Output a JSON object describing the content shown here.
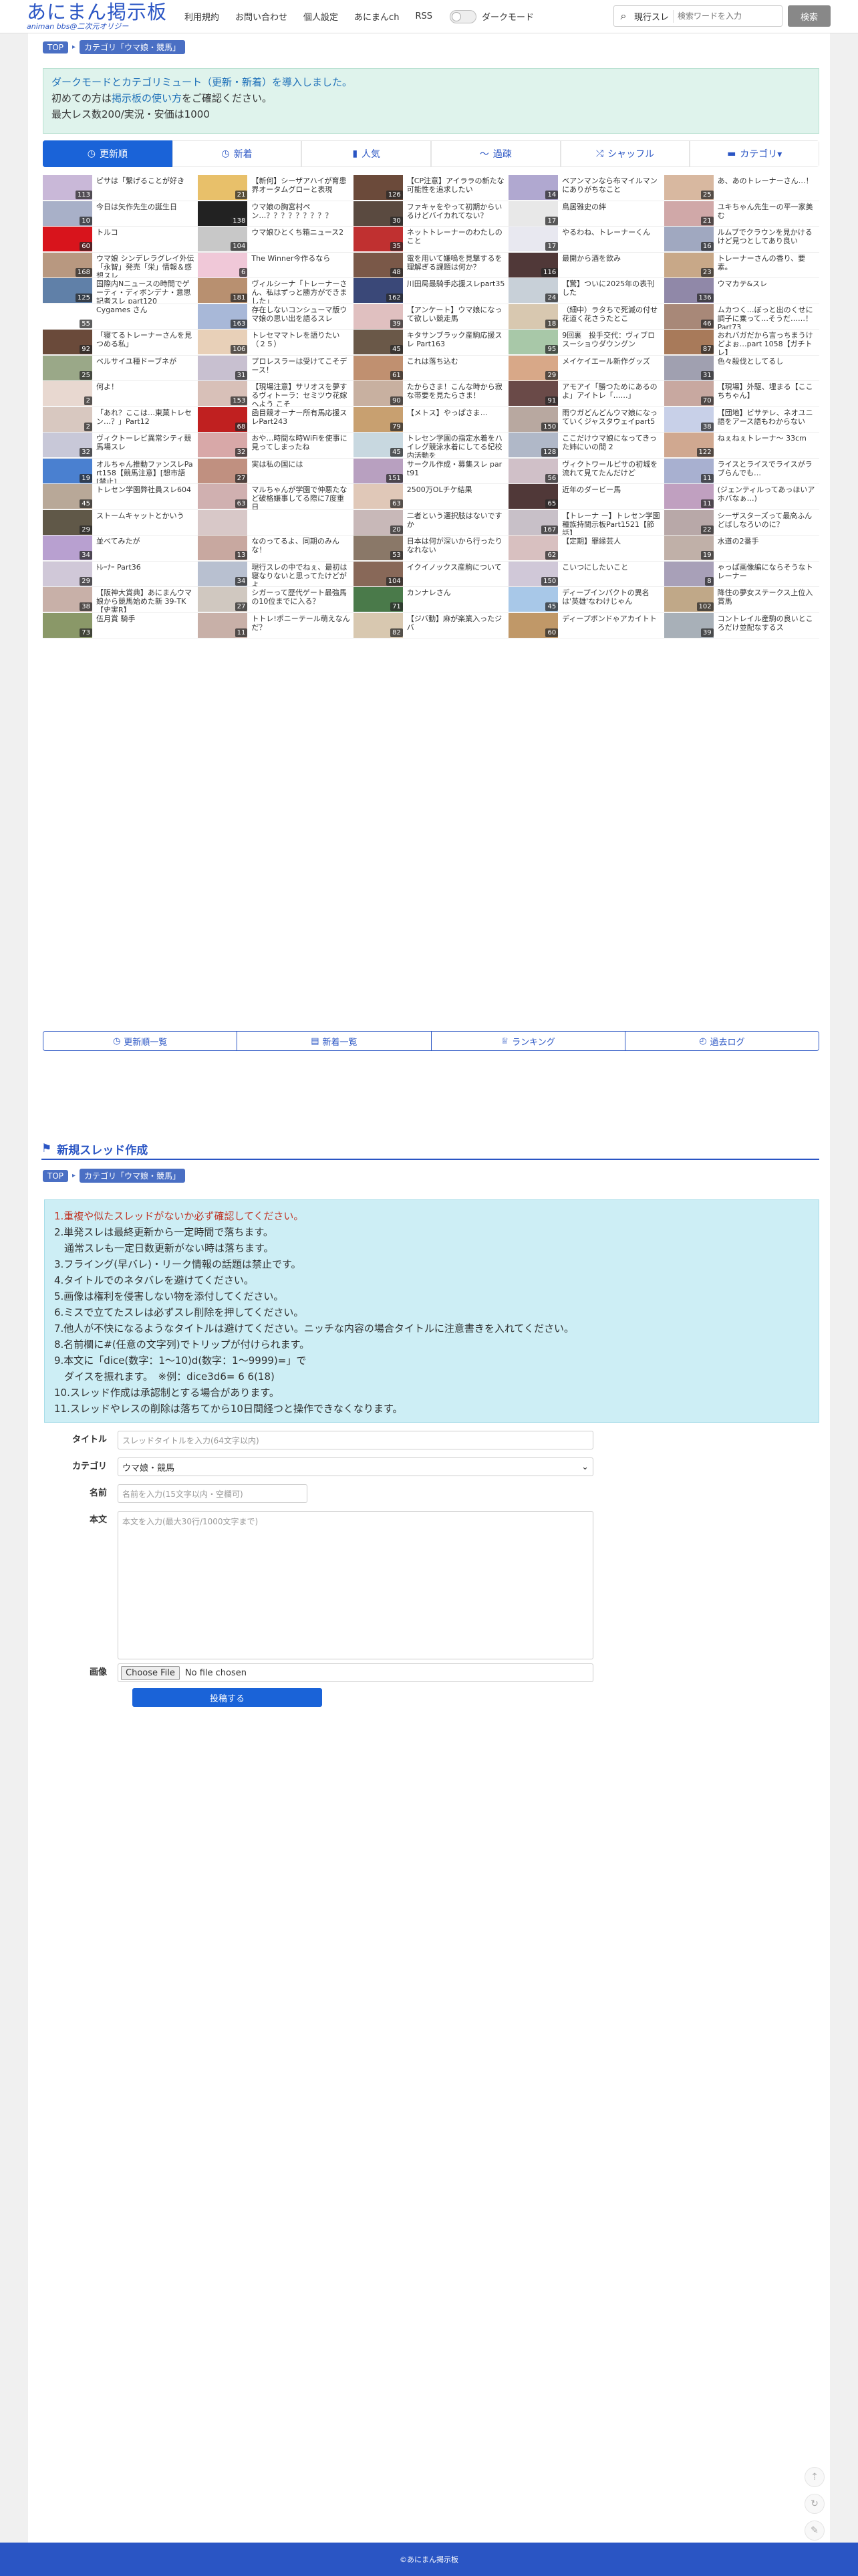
{
  "header": {
    "logo_title": "あにまん掲示板",
    "logo_sub": "animan bbs@二次元オリジー",
    "nav": [
      "利用規約",
      "お問い合わせ",
      "個人設定",
      "あにまんch",
      "RSS"
    ],
    "darkmode_label": "ダークモード",
    "search_scope": "現行スレ",
    "search_placeholder": "検索ワードを入力",
    "search_button": "検索"
  },
  "breadcrumb": {
    "top": "TOP",
    "category": "カテゴリ「ウマ娘・競馬」"
  },
  "notice": {
    "line1": "ダークモードとカテゴリミュート（更新・新着）を導入しました。",
    "line2_pre": "初めての方は",
    "line2_link": "掲示板の使い方",
    "line2_post": "をご確認ください。",
    "line3": "最大レス数200/実況・安価は1000"
  },
  "tabs": [
    {
      "label": "更新順",
      "icon": "clock-icon",
      "glyph": "◷"
    },
    {
      "label": "新着",
      "icon": "clock-icon",
      "glyph": "◷"
    },
    {
      "label": "人気",
      "icon": "bar-chart-icon",
      "glyph": "▮"
    },
    {
      "label": "過疎",
      "icon": "graph-icon",
      "glyph": "〜"
    },
    {
      "label": "シャッフル",
      "icon": "shuffle-icon",
      "glyph": "⤮"
    },
    {
      "label": "カテゴリ▾",
      "icon": "folder-icon",
      "glyph": "▬"
    }
  ],
  "threads": [
    {
      "title": "ピサは「繋げることが好き",
      "count": "113",
      "color": "#c9b8d8"
    },
    {
      "title": "【新何】シーザアハイが育患界オータムグローと表現",
      "count": "21",
      "color": "#e8c06a"
    },
    {
      "title": "【CP注意】アイララの新たな可能性を追求したい",
      "count": "126",
      "color": "#6b4a3a"
    },
    {
      "title": "ベアンマンなら布マイルマンにありがちなこと",
      "count": "14",
      "color": "#b0a8d0"
    },
    {
      "title": "あ、あのトレーナーさん…！",
      "count": "25",
      "color": "#d8b8a0"
    },
    {
      "title": "今日は矢作先生の誕生日",
      "count": "10",
      "color": "#a8b0c8"
    },
    {
      "title": "ウマ娘の胸宮村ペン…？？？？？？？？？",
      "count": "138",
      "color": "#222222"
    },
    {
      "title": "ファキャをやって初期からいるけどバイカれてない？",
      "count": "30",
      "color": "#5a4a40"
    },
    {
      "title": "鳥居雅史の絆",
      "count": "17",
      "color": "#e8e8e8"
    },
    {
      "title": "ユキちゃん先生ーの平一家美む",
      "count": "21",
      "color": "#d0a8a8"
    },
    {
      "title": "トルコ",
      "count": "60",
      "color": "#d8141c"
    },
    {
      "title": "ウマ娘ひとくち箱ニュース2",
      "count": "104",
      "color": "#c8c8c8"
    },
    {
      "title": "ネットトレーナーのわたしのこと",
      "count": "35",
      "color": "#c03030"
    },
    {
      "title": "やるわね、トレーナーくん",
      "count": "17",
      "color": "#e8e8f0"
    },
    {
      "title": "ルムブでクラウンを見かけるけど見つとしてあり良い",
      "count": "16",
      "color": "#a0a8c0"
    },
    {
      "title": "ウマ娘 シンデレラグレイ外伝「永智」発売「栄」情報＆感想スレ",
      "count": "168",
      "color": "#b89880"
    },
    {
      "title": "The Winner今作るなら",
      "count": "6",
      "color": "#f0c8d8"
    },
    {
      "title": "電を用いて嫌嗚を見撃するを理解ぎる課題は何か？",
      "count": "48",
      "color": "#7a5848"
    },
    {
      "title": "最開から酒を飲み",
      "count": "116",
      "color": "#503838"
    },
    {
      "title": "トレーナーさんの香り、要素。",
      "count": "23",
      "color": "#c8a888"
    },
    {
      "title": "国際内Nニュースの時間でゲーティ・ディボンデナ・意思記者スレ part120",
      "count": "125",
      "color": "#6080a8"
    },
    {
      "title": "ヴィルシーナ「トレーナーさん、私はずっと勝方ができました」",
      "count": "181",
      "color": "#b89070"
    },
    {
      "title": "川田局最騎手応援スレpart35",
      "count": "162",
      "color": "#3a4878"
    },
    {
      "title": "【驚】ついに2025年の表刊した",
      "count": "24",
      "color": "#c8d0d8"
    },
    {
      "title": "ウマカテ&スレ",
      "count": "136",
      "color": "#9088a8"
    },
    {
      "title": "Cygames さん",
      "count": "55",
      "color": "#ffffff"
    },
    {
      "title": "存在しないコンシューマ版ウマ娘の思い出を語るスレ",
      "count": "163",
      "color": "#a8b8d8"
    },
    {
      "title": "【アンケート】ウマ娘になって欲しい競走馬",
      "count": "39",
      "color": "#e0c0c0"
    },
    {
      "title": "（細中）ラタちで死滅の付せ花道く花さうたとこ",
      "count": "18",
      "color": "#d8c8b0"
    },
    {
      "title": "ムカつく…ぼっと出のくせに調子に乗って…そうだ……！ Part73",
      "count": "46",
      "color": "#a88878"
    },
    {
      "title": "「寝てるトレーナーさんを見つめる私」",
      "count": "92",
      "color": "#6a4a3a"
    },
    {
      "title": "トレセママトレを語りたい（２５）",
      "count": "106",
      "color": "#e8d0b8"
    },
    {
      "title": "キタサンブラック産駒応援スレ Part163",
      "count": "45",
      "color": "#6a5848"
    },
    {
      "title": "9回裏　投手交代：ヴィブロスーショウダウングン",
      "count": "95",
      "color": "#a8c8a8"
    },
    {
      "title": "おれバガだから言っちまうけどよぉ…part 1058【ガチトレ】",
      "count": "87",
      "color": "#a87a5a"
    },
    {
      "title": "ベルサイユ種ドーブネが",
      "count": "25",
      "color": "#9aa888"
    },
    {
      "title": "プロレスラーは受けてこそデース！",
      "count": "31",
      "color": "#c8c0d0"
    },
    {
      "title": "これは落ち込む",
      "count": "61",
      "color": "#c09070"
    },
    {
      "title": "メイケイエール新作グッズ",
      "count": "29",
      "color": "#d8a888"
    },
    {
      "title": "色々殺伐としてるし",
      "count": "31",
      "color": "#a0a0b0"
    },
    {
      "title": "何よ！",
      "count": "2",
      "color": "#e8d8d0"
    },
    {
      "title": "【現場注意】サリオスを夢するヴィトーラ：セミツウ花嫁ヘよう こそ",
      "count": "153",
      "color": "#d8c0b8"
    },
    {
      "title": "たからさま！こんな時から寂な帯要を見たらさま！",
      "count": "90",
      "color": "#c8b0a0"
    },
    {
      "title": "アモアイ「勝つためにあるのよ」アイトレ「……」",
      "count": "91",
      "color": "#6a4a48"
    },
    {
      "title": "【現場】外駆、埋まる【ここちちゃん】",
      "count": "70",
      "color": "#c8a8a0"
    },
    {
      "title": "「あれ？ここは…東菓トレセン…？」Part12",
      "count": "2",
      "color": "#d8c8c0"
    },
    {
      "title": "函目競オーナー所有馬応援スレPart243",
      "count": "68",
      "color": "#c02020"
    },
    {
      "title": "【メトス】やっぱさま…",
      "count": "79",
      "color": "#c8a070"
    },
    {
      "title": "雨ウガどんどんウマ娘になっていくジャスタウェイpart5",
      "count": "150",
      "color": "#b8a8a0"
    },
    {
      "title": "【団地】ビサテレ、ネオユニ語をアース語もわからない",
      "count": "38",
      "color": "#c8d0e8"
    },
    {
      "title": "ヴィクトーレビ異常シティ競馬場スレ",
      "count": "32",
      "color": "#c8c8d8"
    },
    {
      "title": "おや…時間な時WiFiを使事に見ってしまったね",
      "count": "32",
      "color": "#d8a8a8"
    },
    {
      "title": "トレセン学園の指定水着をハイレグ競泳水着にしてる紀校内活動を",
      "count": "45",
      "color": "#c8d8e0"
    },
    {
      "title": "ここだけウマ娘になってきった姉にいの間 2",
      "count": "128",
      "color": "#b0b8c8"
    },
    {
      "title": "ねぇねぇトレーナ〜 33cm",
      "count": "122",
      "color": "#d0a890"
    },
    {
      "title": "オルちゃん推動ファンスレPart158【競馬注意】[想市語 [禁止]",
      "count": "19",
      "color": "#4a80d0"
    },
    {
      "title": "実は私の国には",
      "count": "27",
      "color": "#c09080"
    },
    {
      "title": "サークル作成・募集スレ par t91",
      "count": "151",
      "color": "#b8a0c0"
    },
    {
      "title": "ヴィクトワールピサの初城を流れて見てたんだけど",
      "count": "56",
      "color": "#d0c0c8"
    },
    {
      "title": "ライスとライスでライスがラブらんでも…",
      "count": "11",
      "color": "#a8b0d0"
    },
    {
      "title": "トレセン学園弊社員スレ604",
      "count": "45",
      "color": "#b8a898"
    },
    {
      "title": "マルちゃんが学園で仲悪たなど破格嫌事してる際に7度重日",
      "count": "63",
      "color": "#d0b0b0"
    },
    {
      "title": "2500万OLチケ結果",
      "count": "63",
      "color": "#e0c8b8"
    },
    {
      "title": "近年のダービー馬",
      "count": "65",
      "color": "#503838"
    },
    {
      "title": "(ジェンティルってあっほいアホバなぁ…)",
      "count": "11",
      "color": "#c0a0c0"
    },
    {
      "title": "ストームキャットとかいう",
      "count": "29",
      "color": "#605848"
    },
    {
      "title": "",
      "count": "",
      "color": "#d8c8c8"
    },
    {
      "title": "二者という選択肢はないですか",
      "count": "20",
      "color": "#c8b8b8"
    },
    {
      "title": "【トレーナ ー】トレセン学園種族持間示板Part1521【節話】",
      "count": "167",
      "color": "#c8c0c8"
    },
    {
      "title": "シーザスターズって最高ふんどばしなろいのに？",
      "count": "22",
      "color": "#b8a8a8"
    },
    {
      "title": "並べてみたが",
      "count": "34",
      "color": "#b8a0d0"
    },
    {
      "title": "なのってるよ、同期のみんな！",
      "count": "13",
      "color": "#c8a8a0"
    },
    {
      "title": "日本は何が深いから行ったりなれない",
      "count": "53",
      "color": "#8a7868"
    },
    {
      "title": "【定期】罪縁芸人",
      "count": "62",
      "color": "#d8c0c0"
    },
    {
      "title": "水道の2番手",
      "count": "19",
      "color": "#c0b0a8"
    },
    {
      "title": "ﾄﾚｰﾅｰ Part36",
      "count": "29",
      "color": "#d0c8d8"
    },
    {
      "title": "現行スレの中でねぇ、最初は寝なりないと思ってたけどがよ",
      "count": "34",
      "color": "#b8c0d0"
    },
    {
      "title": "イクイノックス産駒について",
      "count": "104",
      "color": "#886858"
    },
    {
      "title": "こいつにしたいこと",
      "count": "150",
      "color": "#d0c8d8"
    },
    {
      "title": "ゃっぱ画像編にならそうなトレーナー",
      "count": "8",
      "color": "#a8a0b8"
    },
    {
      "title": "【阪神大賞典】あにまんウマ娘から競馬始めた新 39-TK【史実R】",
      "count": "38",
      "color": "#c8b0a8"
    },
    {
      "title": "シガーって歴代ゲート最強馬の10位までに入る？",
      "count": "27",
      "color": "#d0c8c0"
    },
    {
      "title": "カンナレさん",
      "count": "71",
      "color": "#4a7a4a"
    },
    {
      "title": "ディープインパクトの異名は'英雄'なわけじゃん",
      "count": "45",
      "color": "#a8c8e8"
    },
    {
      "title": "降住の夢女ステークス上位入賞馬",
      "count": "102",
      "color": "#c0a888"
    },
    {
      "title": "伍月賞 騎手",
      "count": "73",
      "color": "#8a9868"
    },
    {
      "title": "トトレ!ポニーテール萌えなんだ？",
      "count": "11",
      "color": "#c8b0a8"
    },
    {
      "title": "【ジバ動】麻が楽業入ったジバ",
      "count": "82",
      "color": "#d8c8b0"
    },
    {
      "title": "ディープボンドゃアカイトト",
      "count": "60",
      "color": "#c09868"
    },
    {
      "title": "コントレイル産駒の良いところだけ並配なするス",
      "count": "39",
      "color": "#a8b0b8"
    }
  ],
  "bottom_links": [
    {
      "label": "更新順一覧",
      "icon": "clock-icon",
      "glyph": "◷"
    },
    {
      "label": "新着一覧",
      "icon": "list-icon",
      "glyph": "▤"
    },
    {
      "label": "ランキング",
      "icon": "ranking-icon",
      "glyph": "♕"
    },
    {
      "label": "過去ログ",
      "icon": "history-icon",
      "glyph": "◴"
    }
  ],
  "new_thread": {
    "heading": "新規スレッド作成",
    "rules": [
      "1.重複や似たスレッドがないか必ず確認してください。",
      "2.単発スレは最終更新から一定時間で落ちます。",
      "　通常スレも一定日数更新がない時は落ちます。",
      "3.フライング(早バレ)・リーク情報の話題は禁止です。",
      "4.タイトルでのネタバレを避けてください。",
      "5.画像は権利を侵害しない物を添付してください。",
      "6.ミスで立てたスレは必ずスレ削除を押してください。",
      "7.他人が不快になるようなタイトルは避けてください。ニッチな内容の場合タイトルに注意書きを入れてください。",
      "8.名前欄に#(任意の文字列)でトリップが付けられます。",
      "9.本文に「dice(数字：1〜10)d(数字：1〜9999)=」で",
      "　ダイスを振れます。　※例：dice3d6= 6 6(18)",
      "10.スレッド作成は承認制とする場合があります。",
      "11.スレッドやレスの削除は落ちてから10日間経つと操作できなくなります。"
    ],
    "title_label": "タイトル",
    "title_placeholder": "スレッドタイトルを入力(64文字以内)",
    "category_label": "カテゴリ",
    "category_value": "ウマ娘・競馬",
    "name_label": "名前",
    "name_placeholder": "名前を入力(15文字以内・空欄可)",
    "body_label": "本文",
    "body_placeholder": "本文を入力(最大30行/1000文字まで)",
    "image_label": "画像",
    "file_button": "Choose File",
    "file_status": "No file chosen",
    "submit": "投稿する"
  },
  "footer": "©あにまん掲示板",
  "colors": {
    "brand": "#2a55c4",
    "active_tab": "#1a63d8",
    "notice_bg": "#dff3ec",
    "rules_bg": "#cdeef5"
  }
}
